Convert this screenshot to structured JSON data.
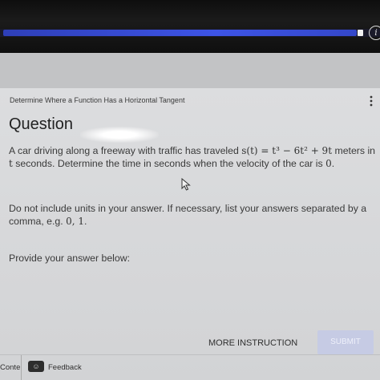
{
  "header": {
    "progress_percent": 93
  },
  "breadcrumb": "Determine Where a Function Has a Horizontal Tangent",
  "question": {
    "title": "Question",
    "p1_a": "A car driving along a freeway with traffic has traveled ",
    "p1_math1": "s(t) = t³ − 6t² + 9t",
    "p1_b": " meters in ",
    "p1_math2": "t",
    "p1_c": " seconds. Determine the time in seconds when the velocity of the car is ",
    "p1_math3": "0",
    "p1_d": ".",
    "p2_a": "Do not include units in your answer. If necessary, list your answers separated by a comma, e.g. ",
    "p2_math": "0, 1",
    "p2_b": ".",
    "p3": "Provide your answer below:"
  },
  "actions": {
    "more_instruction": "MORE INSTRUCTION",
    "submit": "SUBMIT"
  },
  "footer": {
    "content_label": "Conte",
    "feedback_label": "Feedback"
  },
  "colors": {
    "progress": "#3d54e6",
    "submit_bg": "#c6cbe4",
    "card_bg": "#dcdddf"
  },
  "icons": [
    "info-icon",
    "kebab-menu-icon",
    "mouse-cursor-icon",
    "feedback-icon"
  ]
}
